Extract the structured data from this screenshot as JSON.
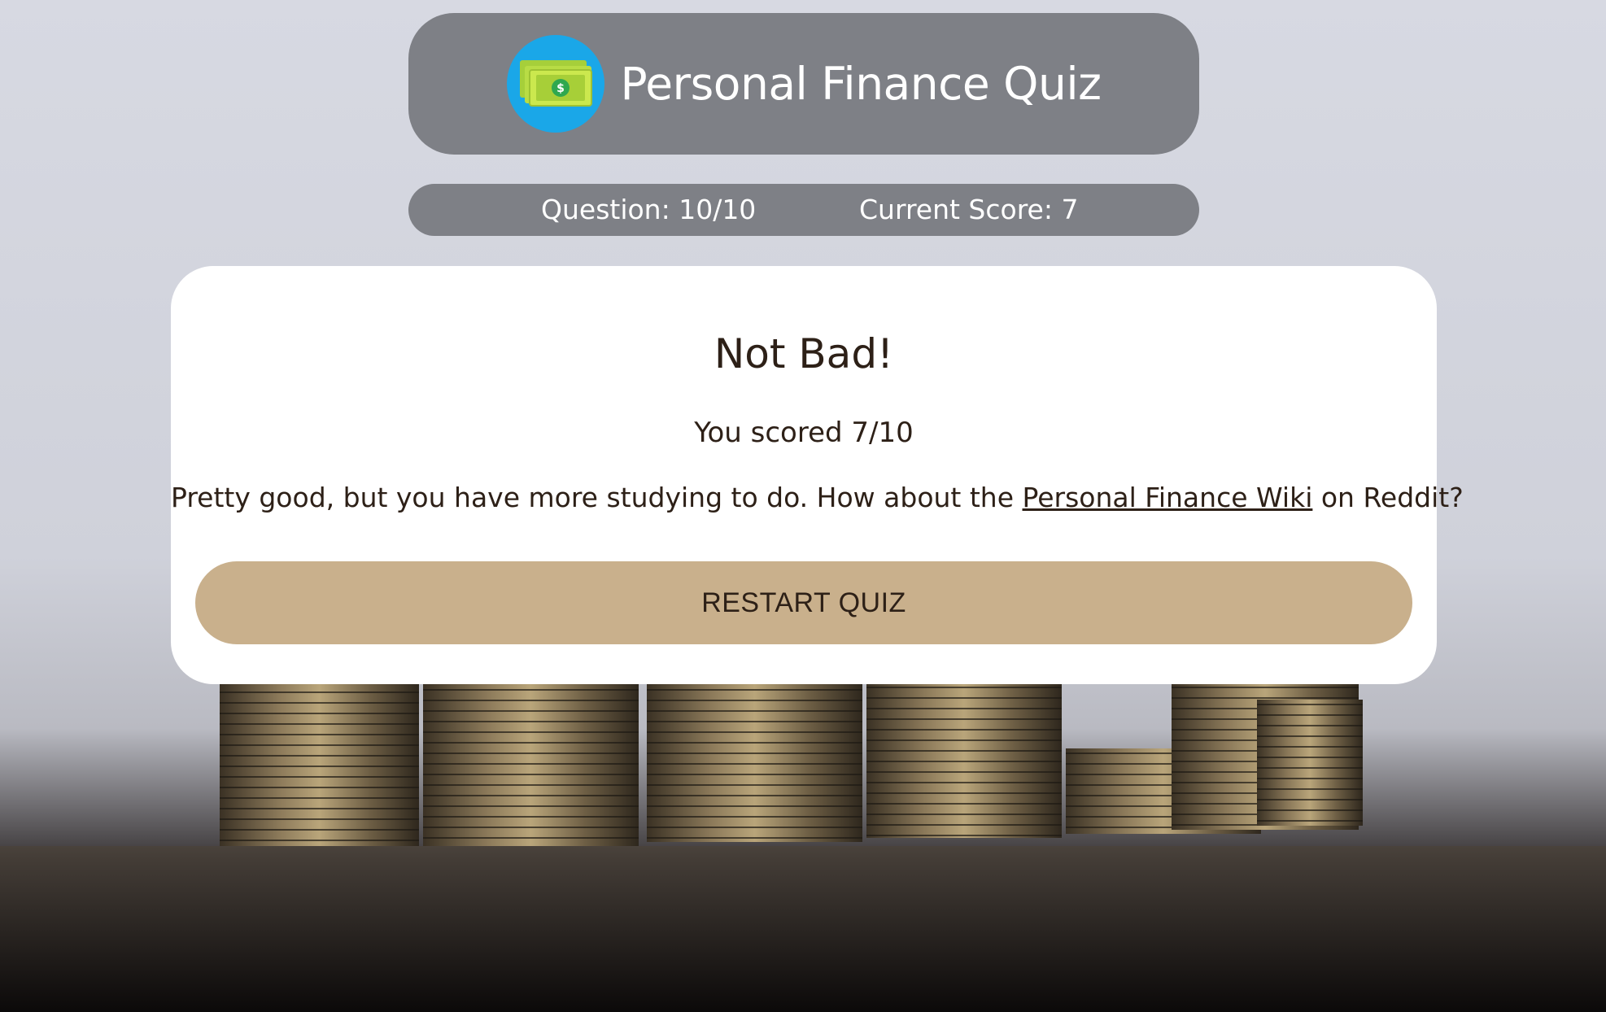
{
  "header": {
    "title": "Personal Finance Quiz",
    "logo_icon": "money-bills-icon",
    "logo_bg_color": "#1aa7e8",
    "logo_symbol": "$"
  },
  "stats": {
    "question_label": "Question: 10/10",
    "score_label": "Current Score: 7"
  },
  "result": {
    "title": "Not Bad!",
    "score_text": "You scored 7/10",
    "message_before": "Pretty good, but you have more studying to do. How about the ",
    "link_text": "Personal Finance Wiki",
    "message_after": " on Reddit?",
    "button_label": "RESTART QUIZ"
  },
  "colors": {
    "bar_background": "#7e8086",
    "button_background": "#c9b08c",
    "text_dark": "#2d2017",
    "page_background": "#d3d5de"
  }
}
